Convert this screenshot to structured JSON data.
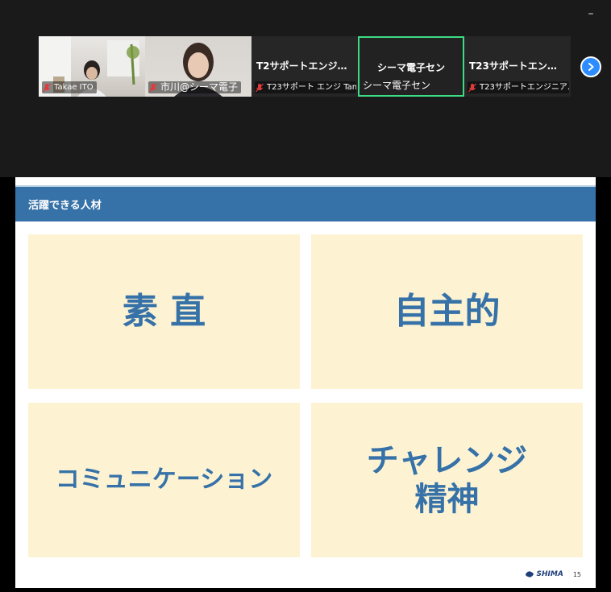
{
  "window": {
    "minimize_label": "–"
  },
  "participants": [
    {
      "name": "Takae ITO",
      "muted": true,
      "video": true
    },
    {
      "name": "市川@シーマ電子",
      "muted": true,
      "video": true
    },
    {
      "display": "T2サポートエンジニア...",
      "name": "T23サポート エンジ Tan",
      "muted": true,
      "video": false
    },
    {
      "display": "シーマ電子セン",
      "name": "シーマ電子セン",
      "muted": false,
      "video": false,
      "active": true
    },
    {
      "display": "T23サポートエンジニア...",
      "name": "T23サポートエンジニア...",
      "muted": true,
      "video": false
    }
  ],
  "slide": {
    "header": "活躍できる人材",
    "boxes": [
      "素 直",
      "自主的",
      "コミュニケーション",
      "チャレンジ\n精神"
    ],
    "logo": "SHIMA",
    "page_number": "15",
    "accent_color": "#3672a8",
    "box_color": "#fdf3d3"
  }
}
